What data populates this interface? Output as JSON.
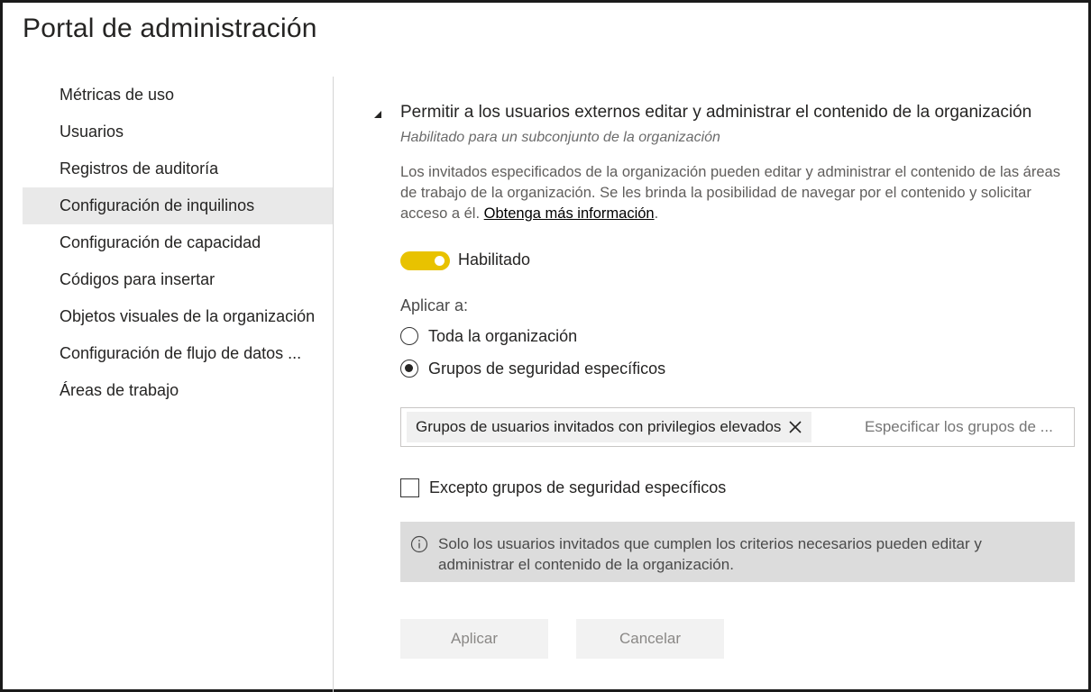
{
  "header": {
    "title": "Portal de administración"
  },
  "sidebar": {
    "items": [
      {
        "label": "Métricas de uso"
      },
      {
        "label": "Usuarios"
      },
      {
        "label": "Registros de auditoría"
      },
      {
        "label": "Configuración de inquilinos",
        "selected": true
      },
      {
        "label": "Configuración de capacidad"
      },
      {
        "label": "Códigos para insertar"
      },
      {
        "label": "Objetos visuales de la organización"
      },
      {
        "label": "Configuración de flujo de datos ..."
      },
      {
        "label": "Áreas de trabajo"
      }
    ]
  },
  "setting": {
    "title": "Permitir a los usuarios externos editar y administrar el contenido de la organización",
    "subtitle": "Habilitado para un subconjunto de la organización",
    "description": "Los invitados especificados de la organización pueden editar y administrar el contenido de las áreas de trabajo de la organización. Se les brinda la posibilidad de navegar por el contenido y solicitar acceso a él.",
    "learn_more": "Obtenga más información",
    "learn_more_suffix": ".",
    "toggle": {
      "label": "Habilitado",
      "on": true
    },
    "apply_to": {
      "label": "Aplicar a:",
      "options": [
        {
          "label": "Toda la organización",
          "checked": false
        },
        {
          "label": "Grupos de seguridad específicos",
          "checked": true
        }
      ]
    },
    "groups": {
      "selected_chip": "Grupos de usuarios invitados con privilegios elevados",
      "placeholder": "Especificar los grupos de ..."
    },
    "except": {
      "label": "Excepto grupos de seguridad específicos",
      "checked": false
    },
    "info": "Solo los usuarios invitados que cumplen los criterios necesarios pueden editar y administrar el contenido de la organización.",
    "buttons": {
      "apply": "Aplicar",
      "cancel": "Cancelar"
    }
  },
  "colors": {
    "toggle_on": "#e8c200",
    "selected_nav_bg": "#e9e9e9",
    "info_bg": "#dcdcdc",
    "button_bg": "#f2f2f2"
  }
}
